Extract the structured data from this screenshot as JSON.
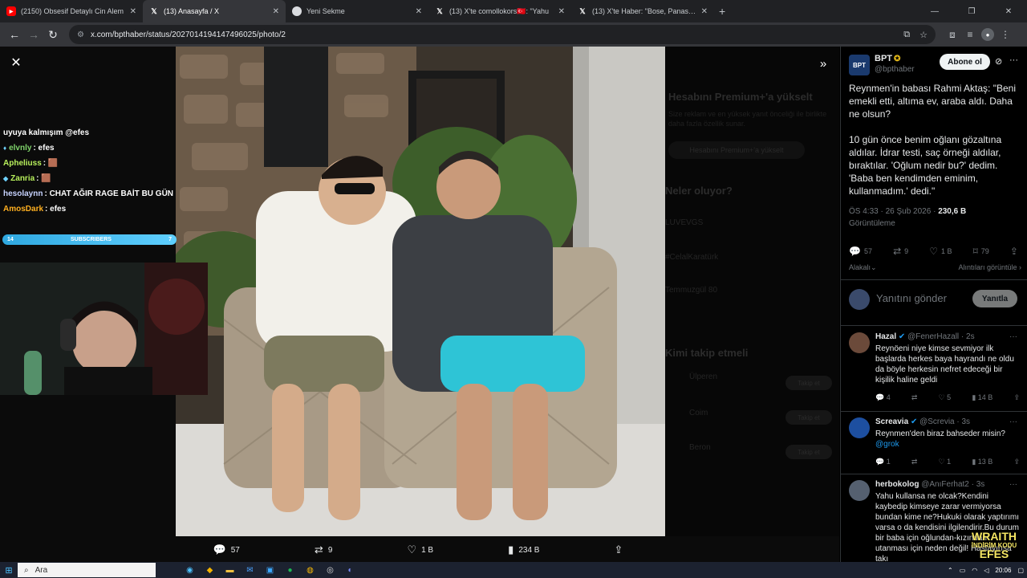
{
  "browser": {
    "tabs": [
      {
        "label": "(2150) Obsesif Detaylı Cin Alem",
        "icon": "youtube-icon",
        "active": false
      },
      {
        "label": "(13) Anasayfa / X",
        "icon": "x-icon",
        "active": true
      },
      {
        "label": "Yeni Sekme",
        "icon": "chrome-icon",
        "active": false
      },
      {
        "label": "(13) X'te comollokors🇹🇷: \"Yahu",
        "icon": "x-icon",
        "active": false
      },
      {
        "label": "(13) X'te Haber: \"Bose, Panason",
        "icon": "x-icon",
        "active": false
      }
    ],
    "url": "x.com/bpthaber/status/2027014194147496025/photo/2"
  },
  "stream_overlay": {
    "chat": [
      {
        "name": "",
        "text": "uyuya kalmışım @efes",
        "color": "#ffffff"
      },
      {
        "name": "elvnly",
        "text": ": efes",
        "color": "#7fd36b"
      },
      {
        "name": "Apheliuss",
        "text": ": 🟫",
        "color": "#b8f05c"
      },
      {
        "name": "Zanria",
        "text": ": 🟫",
        "color": "#b8f05c"
      },
      {
        "name": "hesolaynn",
        "text": ": CHAT AĞIR RAGE BAİT BU GÜN",
        "color": "#c7d3ff"
      },
      {
        "name": "AmosDark",
        "text": ": efes",
        "color": "#ffb020"
      }
    ],
    "subscribers_label": "SUBSCRIBERS",
    "subscribers_count": "14",
    "subscribers_goal": "7"
  },
  "photo_actions": {
    "replies": "57",
    "reposts": "9",
    "likes": "1 B",
    "views": "234 B"
  },
  "post": {
    "name": "BPT",
    "handle": "@bpthaber",
    "avatar_text": "BPT",
    "subscribe_label": "Abone ol",
    "paragraphs": [
      "Reynmen'in babası Rahmi Aktaş: \"Beni emekli etti, altıma ev, araba aldı. Daha ne olsun?",
      "10 gün önce benim oğlanı gözaltına aldılar. İdrar testi, saç örneği aldılar, bıraktılar. 'Oğlum nedir bu?' dedim. 'Baba ben kendimden eminim, kullanmadım.' dedi.\""
    ],
    "timestamp": "ÖS 4:33 · 26 Şub 2026 · ",
    "views_count": "230,6 B",
    "views_label": "Görüntüleme",
    "stats": {
      "replies": "57",
      "reposts": "9",
      "likes": "1 B",
      "bookmarks": "79"
    },
    "relevant_label": "Alakalı",
    "quotes_label": "Alıntıları görüntüle",
    "reply_placeholder": "Yanıtını gönder",
    "reply_button": "Yanıtla"
  },
  "replies": [
    {
      "name": "Hazal",
      "handle": "@FenerHazall · 2s",
      "text": "Reynöeni niye kimse sevmiyor ilk başlarda herkes baya hayrandı ne oldu da böyle herkesin nefret edeceği bir kişilik haline geldi",
      "mention": "",
      "stats": {
        "replies": "4",
        "reposts": "",
        "likes": "5",
        "views": "14 B"
      }
    },
    {
      "name": "Screavia",
      "handle": "@Screvia · 3s",
      "text": "Reynmen'den biraz bahseder misin?",
      "mention": "@grok",
      "stats": {
        "replies": "1",
        "reposts": "",
        "likes": "1",
        "views": "13 B"
      }
    },
    {
      "name": "herbokolog",
      "handle": "@AnıFerhat2 · 3s",
      "text": "Yahu kullansa ne olcak?Kendini kaybedip kimseye zarar vermiyorsa bundan kime ne?Hukuki olarak yaptırımı varsa o da kendisini ilgilendirir.Bu durum bir baba için oğlundan-kızından utanması için neden değil! Hastayırısa takı",
      "mention": "",
      "stats": {
        "replies": "",
        "reposts": "",
        "likes": "",
        "views": ""
      }
    }
  ],
  "ghost_sidebar": {
    "premium_title": "Hesabını Premium+'a yükselt",
    "premium_desc": "Size reklam ve en yüksek yanıt önceliği ile birlikte daha fazla özellik sunar.",
    "premium_button": "Hesabını Premium+'a yükselt",
    "whats_happening": "Neler oluyor?",
    "trends": [
      "LUVEVGS",
      "#CelalKaratürk",
      "Temmuzgül 80"
    ],
    "who_to_follow": "Kimi takip etmeli",
    "suggestions": [
      "Ülperen",
      "Coim",
      "Beron"
    ],
    "follow_label": "Takip et"
  },
  "watermark": {
    "line1": "WRAITH",
    "line2": "İNDİRİM KODU",
    "line3": "EFES"
  },
  "taskbar": {
    "search_placeholder": "Ara",
    "clock": "20:06"
  },
  "colors": {
    "accent": "#1d9bf0",
    "verified_gold": "#e2b719",
    "background": "#000000"
  }
}
